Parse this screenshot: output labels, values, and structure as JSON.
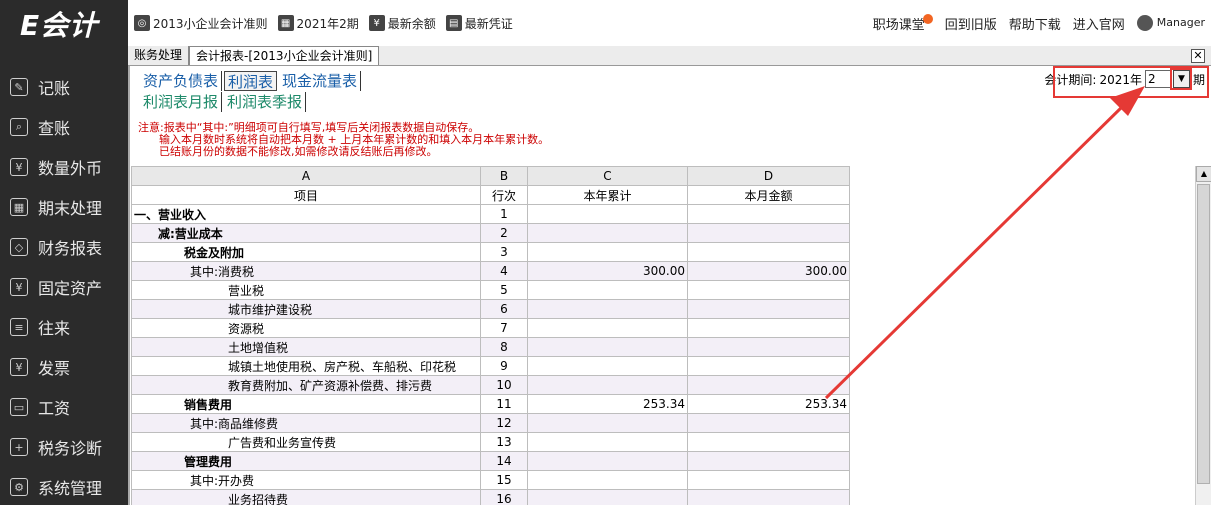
{
  "app": {
    "logo": "E会计"
  },
  "sidebar": {
    "items": [
      {
        "label": "记账",
        "icon": "edit-icon"
      },
      {
        "label": "查账",
        "icon": "search-doc-icon"
      },
      {
        "label": "数量外币",
        "icon": "yen-icon"
      },
      {
        "label": "期末处理",
        "icon": "calendar-icon"
      },
      {
        "label": "财务报表",
        "icon": "report-icon"
      },
      {
        "label": "固定资产",
        "icon": "asset-icon"
      },
      {
        "label": "往来",
        "icon": "exchange-icon"
      },
      {
        "label": "发票",
        "icon": "invoice-icon"
      },
      {
        "label": "工资",
        "icon": "wallet-icon"
      },
      {
        "label": "税务诊断",
        "icon": "tax-icon"
      },
      {
        "label": "系统管理",
        "icon": "gear-icon"
      }
    ]
  },
  "topbar": {
    "accounting_standard": "2013小企业会计准则",
    "period": "2021年2期",
    "latest_balance": "最新余额",
    "latest_voucher": "最新凭证",
    "links": {
      "classroom": "职场课堂",
      "old_version": "回到旧版",
      "help_download": "帮助下载",
      "official_site": "进入官网",
      "user": "Manager"
    }
  },
  "tabbar": {
    "tabs": [
      "账务处理",
      "会计报表-[2013小企业会计准则]"
    ]
  },
  "report_tabs": {
    "row1": [
      "资产负债表",
      "利润表",
      "现金流量表"
    ],
    "row2": [
      "利润表月报",
      "利润表季报"
    ]
  },
  "period_selector": {
    "label": "会计期间:",
    "year": "2021年",
    "value": "2",
    "suffix": "期"
  },
  "notice": {
    "lines": [
      "注意:报表中“其中:”明细项可自行填写,填写后关闭报表数据自动保存。",
      "      输入本月数时系统将自动把本月数 + 上月本年累计数的和填入本月本年累计数。",
      "      已结账月份的数据不能修改,如需修改请反结账后再修改。"
    ]
  },
  "grid": {
    "col_letters": [
      "A",
      "B",
      "C",
      "D"
    ],
    "headers": [
      "项目",
      "行次",
      "本年累计",
      "本月金额"
    ],
    "rows": [
      {
        "item": "一、营业收入",
        "line": "1",
        "ytd": "",
        "month": "",
        "bold": true,
        "indent": 0
      },
      {
        "item": "减:营业成本",
        "line": "2",
        "ytd": "",
        "month": "",
        "bold": true,
        "indent": 1
      },
      {
        "item": "税金及附加",
        "line": "3",
        "ytd": "",
        "month": "",
        "bold": true,
        "indent": 2
      },
      {
        "item": "其中:消费税",
        "line": "4",
        "ytd": "300.00",
        "month": "300.00",
        "bold": false,
        "indent": 3
      },
      {
        "item": "营业税",
        "line": "5",
        "ytd": "",
        "month": "",
        "bold": false,
        "indent": 4
      },
      {
        "item": "城市维护建设税",
        "line": "6",
        "ytd": "",
        "month": "",
        "bold": false,
        "indent": 4
      },
      {
        "item": "资源税",
        "line": "7",
        "ytd": "",
        "month": "",
        "bold": false,
        "indent": 4
      },
      {
        "item": "土地增值税",
        "line": "8",
        "ytd": "",
        "month": "",
        "bold": false,
        "indent": 4
      },
      {
        "item": "城镇土地使用税、房产税、车船税、印花税",
        "line": "9",
        "ytd": "",
        "month": "",
        "bold": false,
        "indent": 4
      },
      {
        "item": "教育费附加、矿产资源补偿费、排污费",
        "line": "10",
        "ytd": "",
        "month": "",
        "bold": false,
        "indent": 4
      },
      {
        "item": "销售费用",
        "line": "11",
        "ytd": "253.34",
        "month": "253.34",
        "bold": true,
        "indent": 2
      },
      {
        "item": "其中:商品维修费",
        "line": "12",
        "ytd": "",
        "month": "",
        "bold": false,
        "indent": 3
      },
      {
        "item": "广告费和业务宣传费",
        "line": "13",
        "ytd": "",
        "month": "",
        "bold": false,
        "indent": 4
      },
      {
        "item": "管理费用",
        "line": "14",
        "ytd": "",
        "month": "",
        "bold": true,
        "indent": 2
      },
      {
        "item": "其中:开办费",
        "line": "15",
        "ytd": "",
        "month": "",
        "bold": false,
        "indent": 3
      },
      {
        "item": "业务招待费",
        "line": "16",
        "ytd": "",
        "month": "",
        "bold": false,
        "indent": 4
      }
    ]
  },
  "colors": {
    "sidebar_bg": "#2b2b2b",
    "annotation_red": "#e53935",
    "notice_red": "#cc0000",
    "tab_blue": "#1a5fa8",
    "tab_green": "#1e8a6a"
  }
}
